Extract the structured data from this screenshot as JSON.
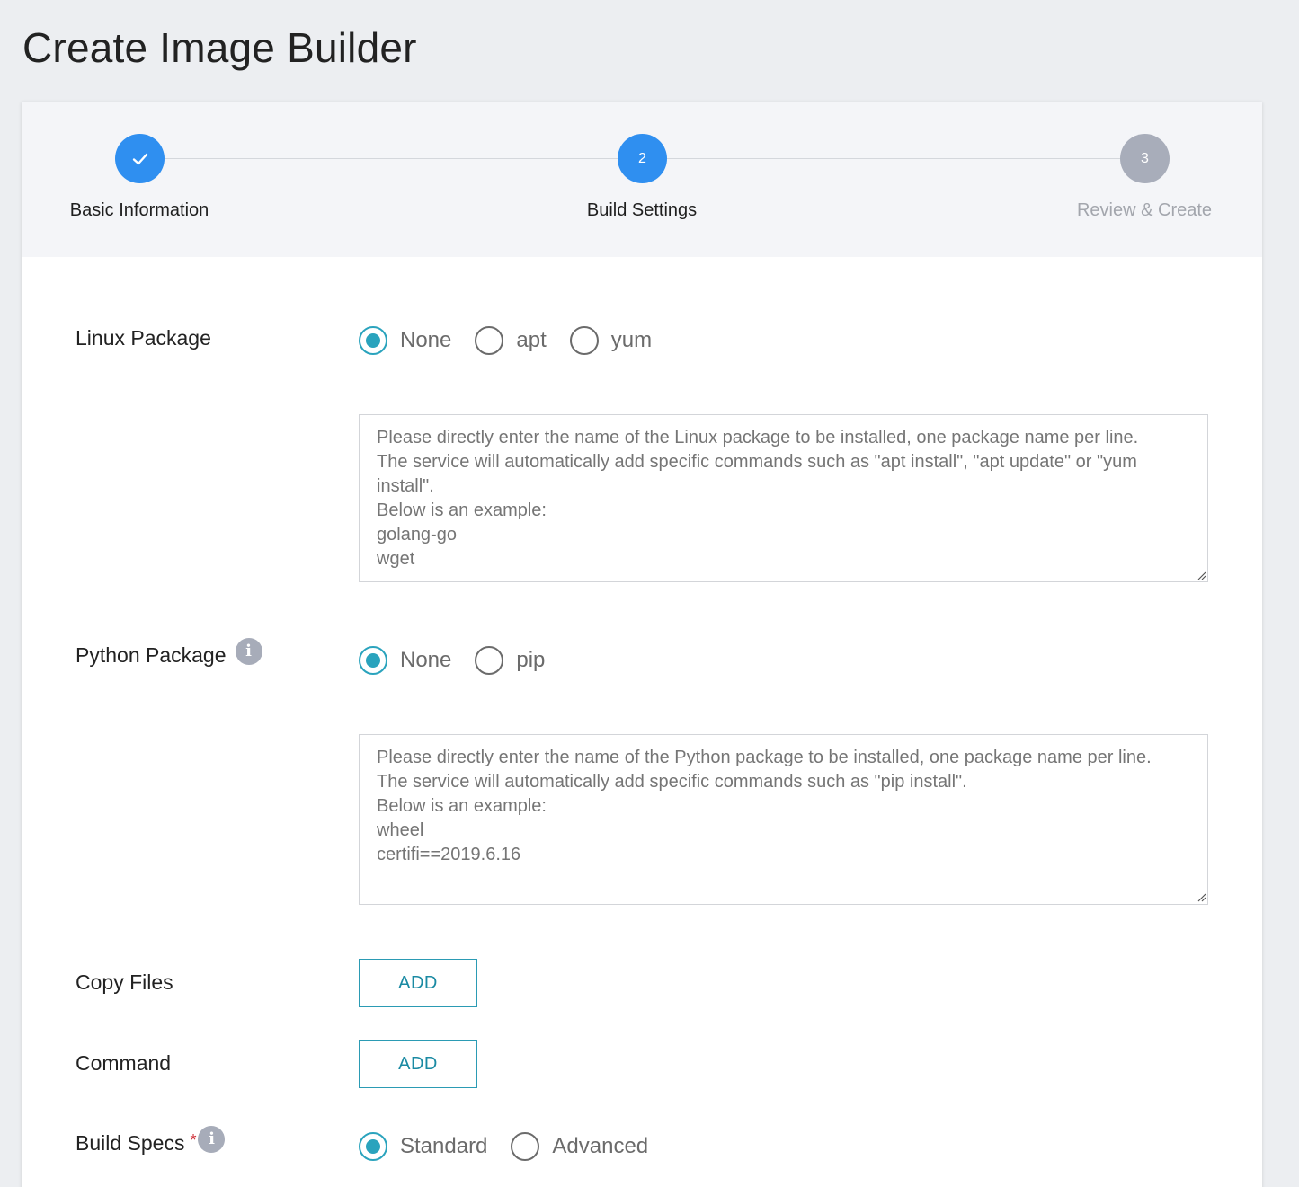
{
  "page": {
    "title": "Create Image Builder"
  },
  "stepper": {
    "steps": [
      {
        "number": "",
        "label": "Basic Information",
        "state": "done"
      },
      {
        "number": "2",
        "label": "Build Settings",
        "state": "current"
      },
      {
        "number": "3",
        "label": "Review & Create",
        "state": "pending"
      }
    ]
  },
  "linux_package": {
    "label": "Linux Package",
    "options": [
      "None",
      "apt",
      "yum"
    ],
    "selected": "None",
    "placeholder": "Please directly enter the name of the Linux package to be installed, one package name per line.\nThe service will automatically add specific commands such as \"apt install\", \"apt update\" or \"yum install\".\nBelow is an example:\ngolang-go\nwget"
  },
  "python_package": {
    "label": "Python Package",
    "options": [
      "None",
      "pip"
    ],
    "selected": "None",
    "placeholder": "Please directly enter the name of the Python package to be installed, one package name per line.\nThe service will automatically add specific commands such as \"pip install\".\nBelow is an example:\nwheel\ncertifi==2019.6.16"
  },
  "copy_files": {
    "label": "Copy Files",
    "button": "ADD"
  },
  "command": {
    "label": "Command",
    "button": "ADD"
  },
  "build_specs": {
    "label": "Build Specs",
    "required_mark": "*",
    "options": [
      "Standard",
      "Advanced"
    ],
    "selected": "Standard"
  },
  "icons": {
    "info": "info-icon",
    "check": "check-icon"
  },
  "colors": {
    "accent": "#2f8ff0",
    "radio": "#2aa3bd",
    "button": "#1a8aa3",
    "pending": "#a8adba",
    "required": "#d0323a"
  }
}
